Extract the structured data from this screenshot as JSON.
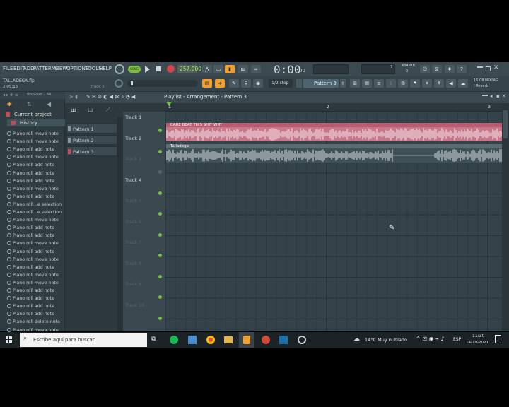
{
  "menu": [
    "FILE",
    "EDIT",
    "ADD",
    "PATTERNS",
    "VIEW",
    "OPTIONS",
    "TOOLS",
    "HELP"
  ],
  "project": {
    "file": "TALLADEGA.flp",
    "time": "2:05:15",
    "hint": "Track 5"
  },
  "transport": {
    "tempo": "257.000",
    "time_display": "0:00",
    "time_small": "00",
    "snap": "1/2 step",
    "pattern": "Pattern 3",
    "cpu": "7",
    "mem": "434 MB",
    "voices": "0",
    "mixer_hint": "16:08  MIXING",
    "mixer_hint2": "| Reverb"
  },
  "browser": {
    "title": "Browser - All",
    "current_project": "Current project",
    "history": "History",
    "items": [
      "Piano roll move note",
      "Piano roll move note",
      "Piano roll add note",
      "Piano roll move note",
      "Piano roll add note",
      "Piano roll add note",
      "Piano roll add note",
      "Piano roll move note",
      "Piano roll add note",
      "Piano roll...e selection",
      "Piano roll...e selection",
      "Piano roll move note",
      "Piano roll add note",
      "Piano roll add note",
      "Piano roll move note",
      "Piano roll add note",
      "Piano roll move note",
      "Piano roll add note",
      "Piano roll move note",
      "Piano roll move note",
      "Piano roll add note",
      "Piano roll add note",
      "Piano roll add note",
      "Piano roll add note",
      "Piano roll delete note",
      "Piano roll move note"
    ]
  },
  "playlist": {
    "title": "Playlist - Arrangement - Pattern 3",
    "ruler": [
      "1",
      "2",
      "3"
    ]
  },
  "patterns": [
    "Pattern 1",
    "Pattern 2",
    "Pattern 3"
  ],
  "tracks": [
    "Track 1",
    "Track 2",
    "Track 3",
    "Track 4",
    "Track 5",
    "Track 6",
    "Track 7",
    "Track 8",
    "Track 9",
    "Track 10"
  ],
  "clips": {
    "clip1": "CARE BEAT THIS SHIT WRY",
    "clip2": "Talladega"
  },
  "taskbar": {
    "search": "Escribe aquí para buscar",
    "weather": "14°C  Muy nublado",
    "lang": "ESP",
    "time": "11:30",
    "date": "14-10-2021"
  },
  "colors": {
    "accent": "#f0a030",
    "clip1": "#c8768a",
    "clip2": "#3f5057",
    "active_track": "#79c24a"
  }
}
